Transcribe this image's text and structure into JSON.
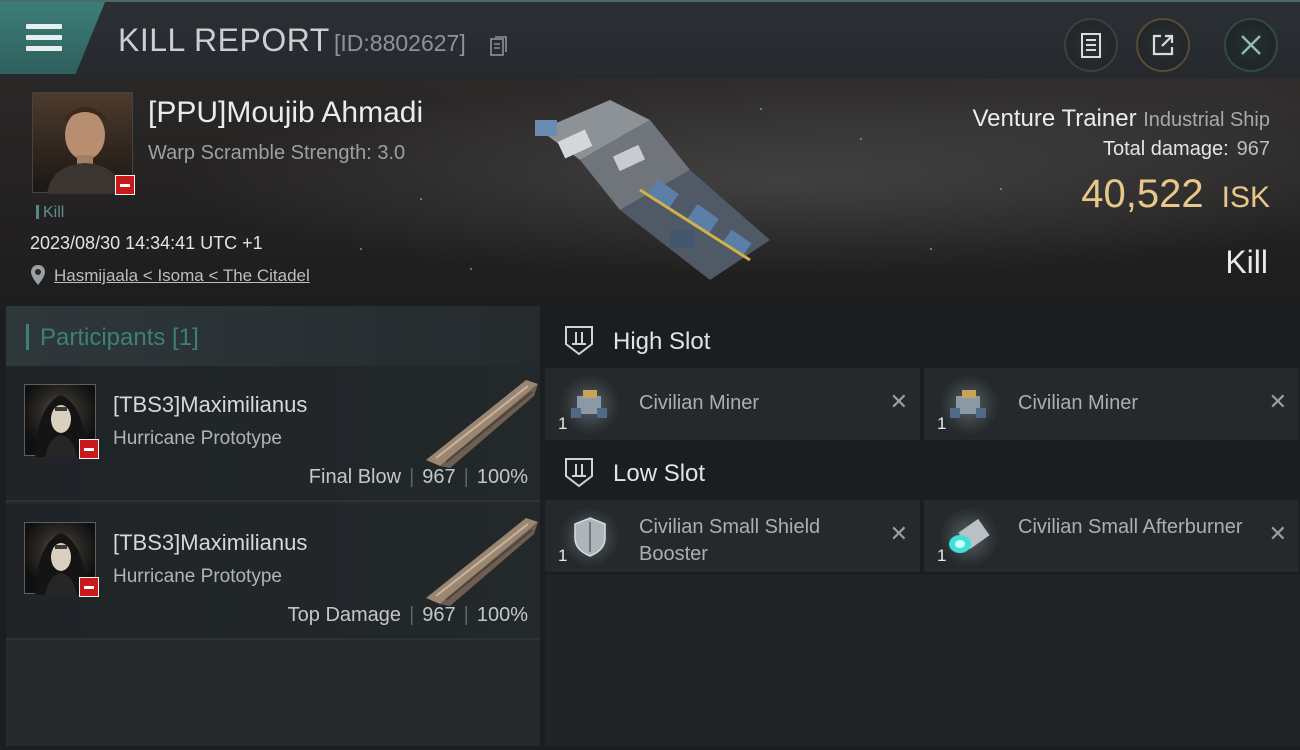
{
  "header": {
    "title": "KILL REPORT",
    "report_id": "[ID:8802627]",
    "colors": {
      "accent": "#3f7f7a",
      "isk_gold": "#e7c78a"
    }
  },
  "victim": {
    "name": "[PPU]Moujib Ahmadi",
    "warp_scramble": "Warp Scramble Strength: 3.0",
    "tag": "Kill",
    "timestamp": "2023/08/30 14:34:41 UTC +1",
    "location": "Hasmijaala < Isoma < The Citadel",
    "ship_name": "Venture Trainer",
    "ship_class": "Industrial Ship",
    "total_damage_label": "Total damage:",
    "total_damage": "967",
    "isk_value": "40,522",
    "isk_unit": "ISK",
    "kill_type": "Kill"
  },
  "participants": {
    "title": "Participants [1]",
    "rows": [
      {
        "name": "[TBS3]Maximilianus",
        "ship": "Hurricane Prototype",
        "role": "Final Blow",
        "damage": "967",
        "percent": "100%"
      },
      {
        "name": "[TBS3]Maximilianus",
        "ship": "Hurricane Prototype",
        "role": "Top Damage",
        "damage": "967",
        "percent": "100%"
      }
    ]
  },
  "fitting": {
    "high_slot": {
      "title": "High Slot",
      "modules": [
        {
          "name": "Civilian Miner",
          "qty": "1",
          "icon": "miner-icon"
        },
        {
          "name": "Civilian Miner",
          "qty": "1",
          "icon": "miner-icon"
        }
      ]
    },
    "low_slot": {
      "title": "Low Slot",
      "modules": [
        {
          "name": "Civilian Small Shield Booster",
          "qty": "1",
          "icon": "shield-booster-icon"
        },
        {
          "name": "Civilian Small Afterburner",
          "qty": "1",
          "icon": "afterburner-icon"
        }
      ]
    }
  }
}
